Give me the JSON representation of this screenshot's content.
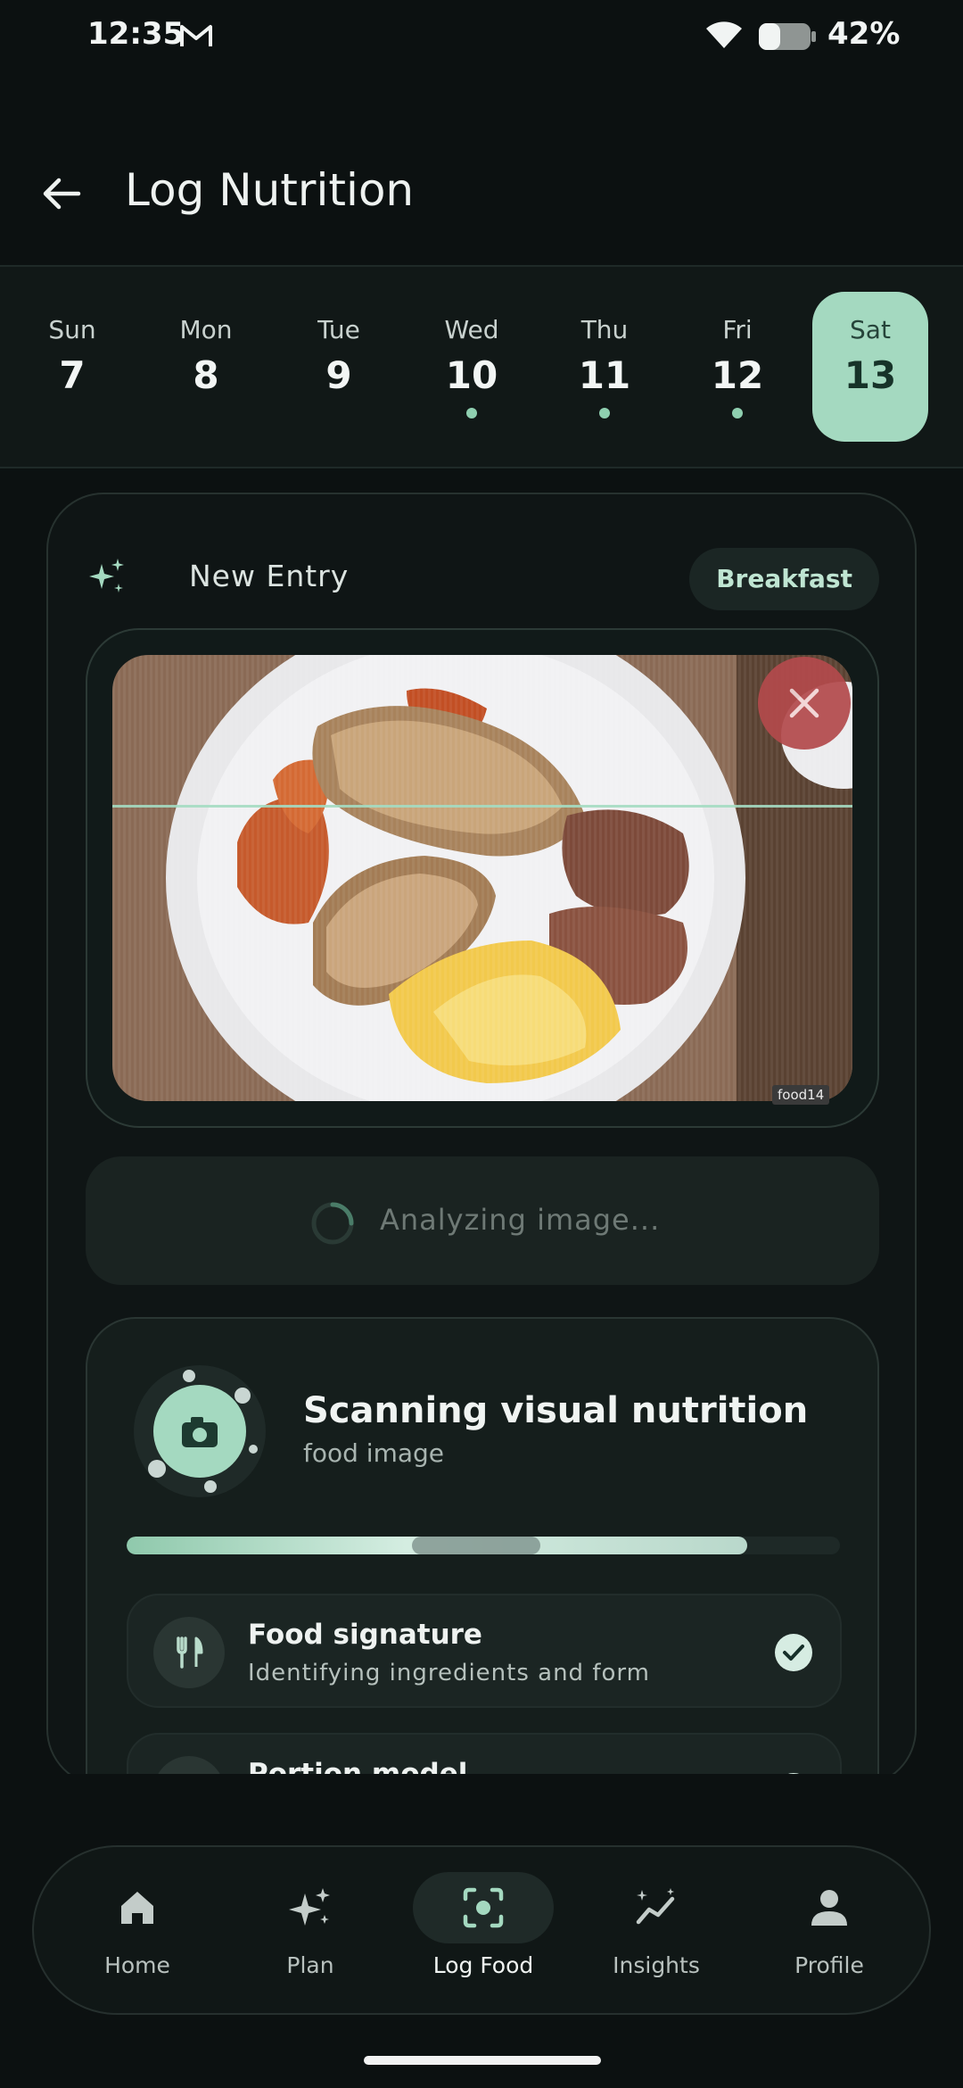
{
  "status_bar": {
    "time": "12:35",
    "battery_percent": "42%",
    "battery_level": 0.42
  },
  "header": {
    "title": "Log Nutrition"
  },
  "days": [
    {
      "name": "Sun",
      "date": "7",
      "has_entry": false
    },
    {
      "name": "Mon",
      "date": "8",
      "has_entry": false
    },
    {
      "name": "Tue",
      "date": "9",
      "has_entry": false
    },
    {
      "name": "Wed",
      "date": "10",
      "has_entry": true
    },
    {
      "name": "Thu",
      "date": "11",
      "has_entry": true
    },
    {
      "name": "Fri",
      "date": "12",
      "has_entry": true
    },
    {
      "name": "Sat",
      "date": "13",
      "has_entry": false,
      "selected": true
    }
  ],
  "entry": {
    "title": "New Entry",
    "meal": "Breakfast",
    "photo_tag": "food14"
  },
  "analyzing": {
    "label": "Analyzing image..."
  },
  "scan": {
    "title": "Scanning visual nutrition",
    "subtitle": "food image",
    "progress": 0.87,
    "steps": [
      {
        "title": "Food signature",
        "description": "Identifying ingredients and form",
        "icon": "utensils-icon",
        "done": true
      },
      {
        "title": "Portion model",
        "description": "",
        "icon": "scale-icon",
        "done": true
      }
    ]
  },
  "nav": {
    "items": [
      {
        "label": "Home",
        "icon": "home-icon"
      },
      {
        "label": "Plan",
        "icon": "sparkle-icon"
      },
      {
        "label": "Log Food",
        "icon": "scan-icon",
        "active": true
      },
      {
        "label": "Insights",
        "icon": "trend-icon"
      },
      {
        "label": "Profile",
        "icon": "person-icon"
      }
    ]
  },
  "colors": {
    "accent": "#a4d9c0",
    "background": "#0c1111",
    "danger": "#b34a4c"
  }
}
